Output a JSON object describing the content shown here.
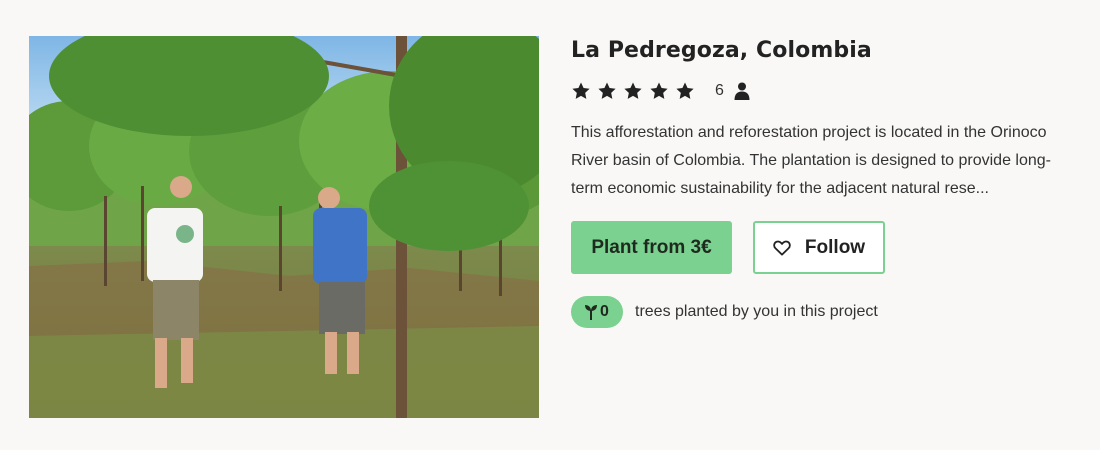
{
  "project": {
    "title": "La Pedregoza, Colombia",
    "image_icon": "project-photo",
    "rating": {
      "stars": 5,
      "max_stars": 5,
      "star_icon": "star-icon",
      "count": "6",
      "count_icon": "person-icon"
    },
    "description": "This afforestation and reforestation project is located in the Orinoco River basin of Colombia. The plantation is designed to provide long-term economic sustainability for the adjacent natural rese...",
    "actions": {
      "plant_label": "Plant from 3€",
      "follow_label": "Follow",
      "follow_icon": "heart-icon"
    },
    "planted": {
      "count": "0",
      "icon": "sprout-icon",
      "text": "trees planted by you in this project"
    }
  },
  "colors": {
    "accent": "#7bd18f",
    "background": "#f9f8f6",
    "text": "#333333"
  }
}
